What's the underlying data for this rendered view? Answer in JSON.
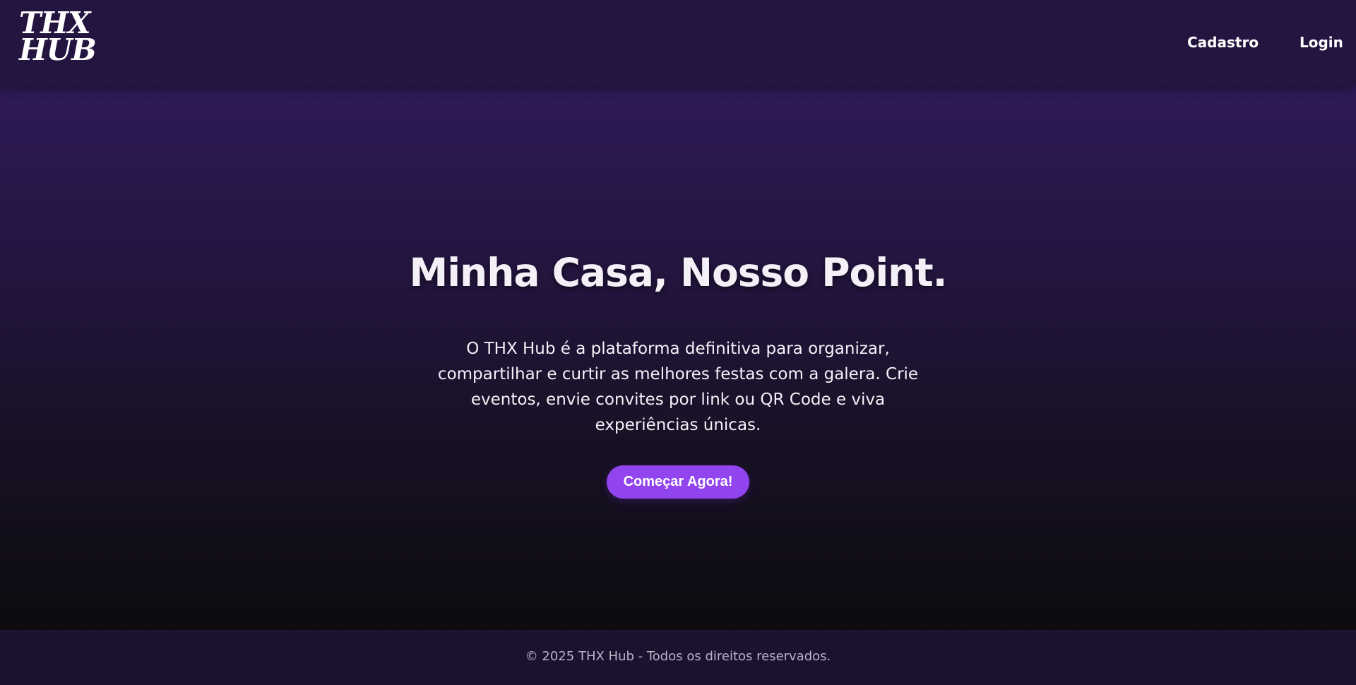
{
  "header": {
    "logo_line1": "THX",
    "logo_line2": "HUB",
    "nav": {
      "cadastro_label": "Cadastro",
      "login_label": "Login"
    }
  },
  "hero": {
    "title": "Minha Casa, Nosso Point.",
    "description": "O THX Hub é a plataforma definitiva para organizar, compartilhar e curtir as melhores festas com a galera. Crie eventos, envie convites por link ou QR Code e viva experiências únicas.",
    "cta_label": "Começar Agora!"
  },
  "footer": {
    "copyright": "© 2025 THX Hub - Todos os direitos reservados."
  },
  "colors": {
    "header_bg": "#231540",
    "accent": "#9244ef",
    "footer_bg": "#1c112f",
    "hero_top": "#2f1a56",
    "hero_bottom": "#0d0b10"
  }
}
